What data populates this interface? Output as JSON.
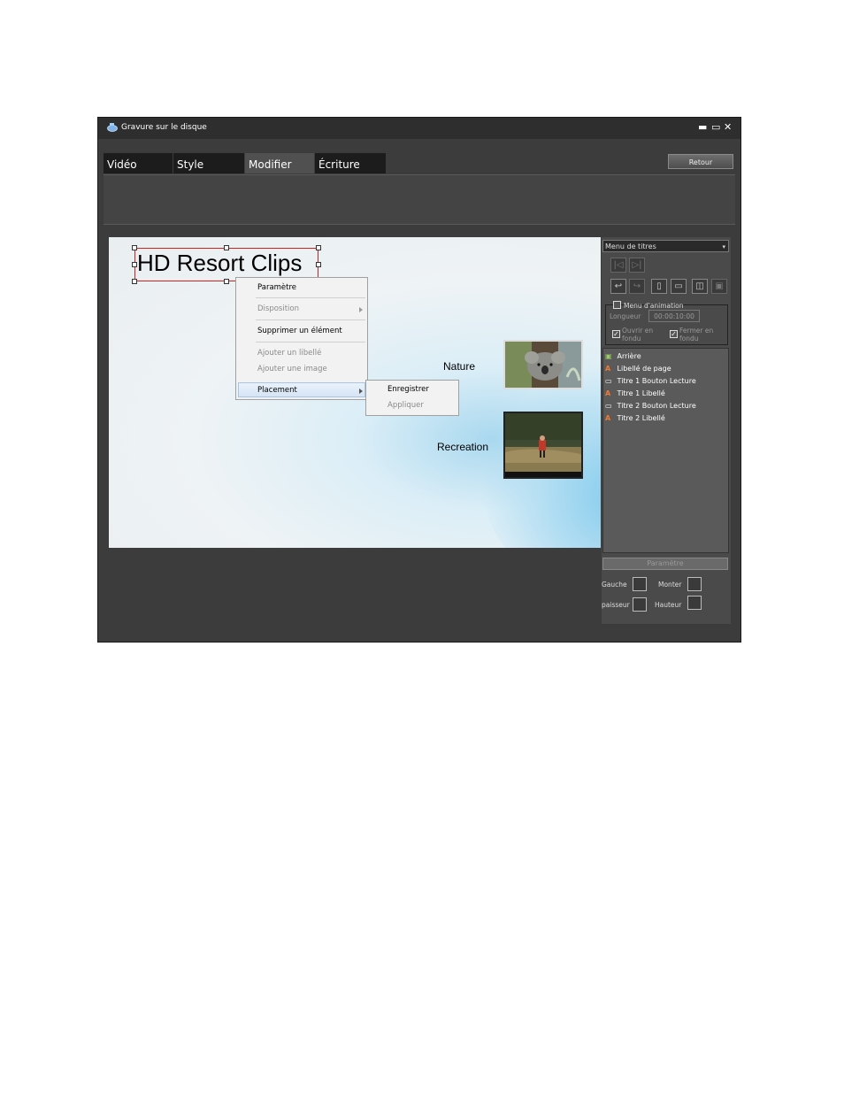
{
  "window": {
    "title": "Gravure sur le disque",
    "minimize": "▬",
    "maximize": "▭",
    "close": "✕"
  },
  "tabs": [
    {
      "label": "Vidéo"
    },
    {
      "label": "Style"
    },
    {
      "label": "Modifier"
    },
    {
      "label": "Écriture"
    }
  ],
  "retour_label": "Retour",
  "preview": {
    "title": "HD Resort Clips",
    "labels": [
      "Nature",
      "Recreation"
    ]
  },
  "context_menu": {
    "items": [
      "Paramètre",
      "Disposition",
      "Supprimer un élément",
      "Ajouter un libellé",
      "Ajouter une image",
      "Placement"
    ],
    "submenu": [
      "Enregistrer",
      "Appliquer"
    ]
  },
  "panel": {
    "dropdown": "Menu de titres",
    "anim_menu": "Menu d'animation",
    "longueur_label": "Longueur",
    "longueur_value": "00:00:10:00",
    "fade_in": "Ouvrir en fondu",
    "fade_out": "Fermer en fondu",
    "layers": [
      {
        "icon": "image-icon",
        "text": "Arrière"
      },
      {
        "icon": "text-icon",
        "text": "Libellé de page"
      },
      {
        "icon": "button-icon",
        "text": "Titre 1  Bouton Lecture"
      },
      {
        "icon": "text-icon",
        "text": "Titre 1  Libellé"
      },
      {
        "icon": "button-icon",
        "text": "Titre 2  Bouton Lecture"
      },
      {
        "icon": "text-icon",
        "text": "Titre 2  Libellé"
      }
    ],
    "params_button": "Paramètre",
    "fields": {
      "gauche": "Gauche",
      "monter": "Monter",
      "epaisseur": "paisseur",
      "hauteur": "Hauteur"
    }
  }
}
